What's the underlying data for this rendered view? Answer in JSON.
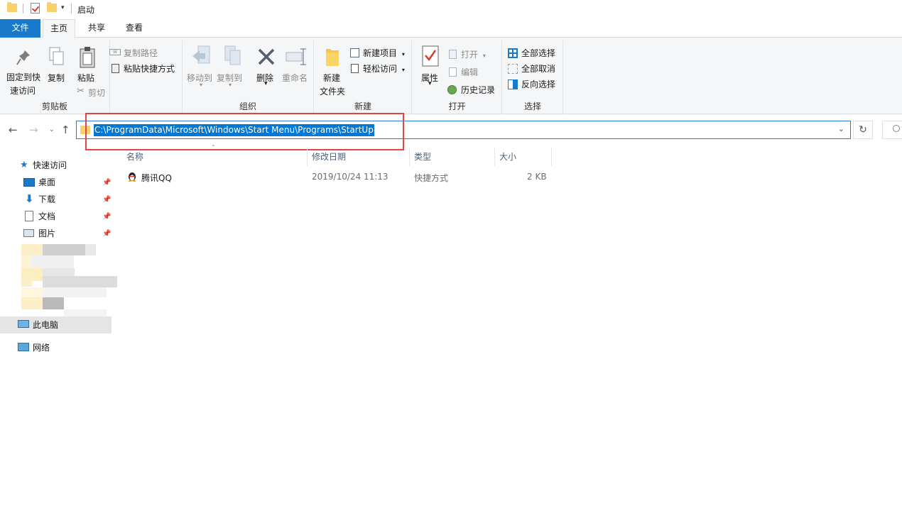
{
  "window": {
    "title": "启动"
  },
  "tabs": {
    "file": "文件",
    "home": "主页",
    "share": "共享",
    "view": "查看"
  },
  "ribbon": {
    "clipboard": {
      "pin": "固定到快\n速访问",
      "pin_l1": "固定到快",
      "pin_l2": "速访问",
      "copy": "复制",
      "paste": "粘贴",
      "copy_path": "复制路径",
      "paste_shortcut": "粘贴快捷方式",
      "cut": "剪切",
      "label": "剪贴板"
    },
    "organize": {
      "move_to": "移动到",
      "copy_to": "复制到",
      "delete": "删除",
      "rename": "重命名",
      "label": "组织"
    },
    "new": {
      "new_folder_l1": "新建",
      "new_folder_l2": "文件夹",
      "new_item": "新建项目",
      "easy_access": "轻松访问",
      "label": "新建"
    },
    "open": {
      "properties": "属性",
      "open": "打开",
      "edit": "编辑",
      "history": "历史记录",
      "label": "打开"
    },
    "select": {
      "select_all": "全部选择",
      "select_none": "全部取消",
      "invert": "反向选择",
      "label": "选择"
    }
  },
  "address": {
    "path": "C:\\ProgramData\\Microsoft\\Windows\\Start Menu\\Programs\\StartUp"
  },
  "sidebar": {
    "quick_access": "快速访问",
    "items": [
      "桌面",
      "下载",
      "文档",
      "图片"
    ],
    "this_pc": "此电脑",
    "network": "网络"
  },
  "columns": {
    "name": "名称",
    "modified": "修改日期",
    "type": "类型",
    "size": "大小"
  },
  "files": [
    {
      "name": "腾讯QQ",
      "modified": "2019/10/24 11:13",
      "type": "快捷方式",
      "size": "2 KB"
    }
  ],
  "colors": {
    "accent": "#1979ca",
    "selection": "#0078d7",
    "annotation": "#e84344"
  }
}
